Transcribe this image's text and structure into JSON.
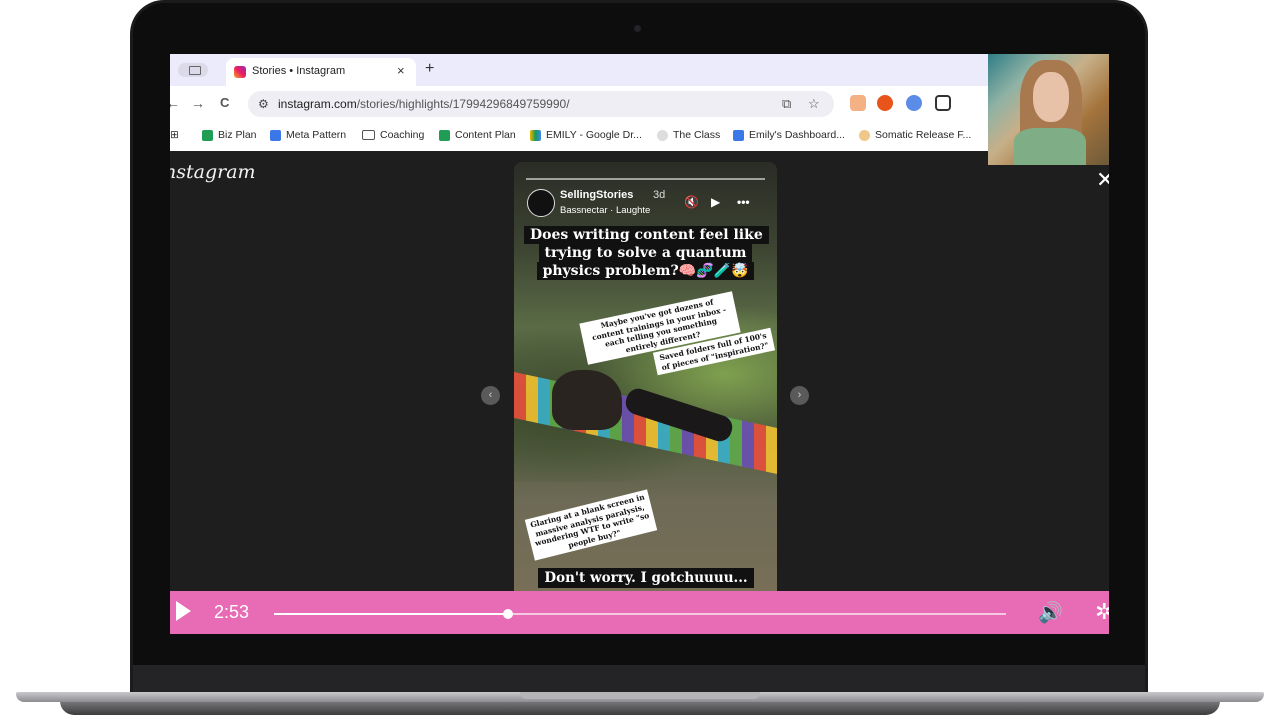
{
  "browser": {
    "tab": {
      "title": "Stories • Instagram",
      "close_glyph": "×"
    },
    "new_tab_glyph": "+",
    "nav": {
      "back": "←",
      "forward": "→",
      "reload": "C"
    },
    "url": {
      "domain": "instagram.com",
      "path": "/stories/highlights/17994296849759990/"
    },
    "bookmarks": [
      {
        "label": "Biz Plan",
        "icon": "sheets-icon"
      },
      {
        "label": "Meta Pattern",
        "icon": "docs-icon"
      },
      {
        "label": "Coaching",
        "icon": "folder-icon"
      },
      {
        "label": "Content Plan",
        "icon": "sheets-icon"
      },
      {
        "label": "EMILY - Google Dr...",
        "icon": "drive-icon"
      },
      {
        "label": "The Class",
        "icon": "link-icon"
      },
      {
        "label": "Emily's Dashboard...",
        "icon": "docs-icon"
      },
      {
        "label": "Somatic Release F...",
        "icon": "site-icon"
      }
    ]
  },
  "instagram": {
    "logo": "nstagram",
    "close_glyph": "✕",
    "story": {
      "username": "SellingStories",
      "time": "3d",
      "song": "Bassnectar · Laughte",
      "headline": "Does writing content feel like trying to solve a quantum physics problem?🧠🧬🧪🤯",
      "sticker1": "Maybe you've got dozens of content trainings in your inbox - each telling you something entirely different?",
      "sticker2": "Saved folders full of 100's of pieces of \"inspiration?\"",
      "sticker3": "Glaring at a blank screen in massive analysis paralysis, wondering WTF to write \"so people buy?\"",
      "bottom_caption": "Don't worry. I gotchuuuu..."
    },
    "prev_glyph": "‹",
    "next_glyph": "›"
  },
  "player": {
    "timecode": "2:53",
    "progress_fraction": 0.32,
    "volume_glyph": "🔊",
    "settings_glyph": "✲"
  },
  "colors": {
    "player_accent": "#e86bb5",
    "tabstrip": "#ecebfb"
  }
}
